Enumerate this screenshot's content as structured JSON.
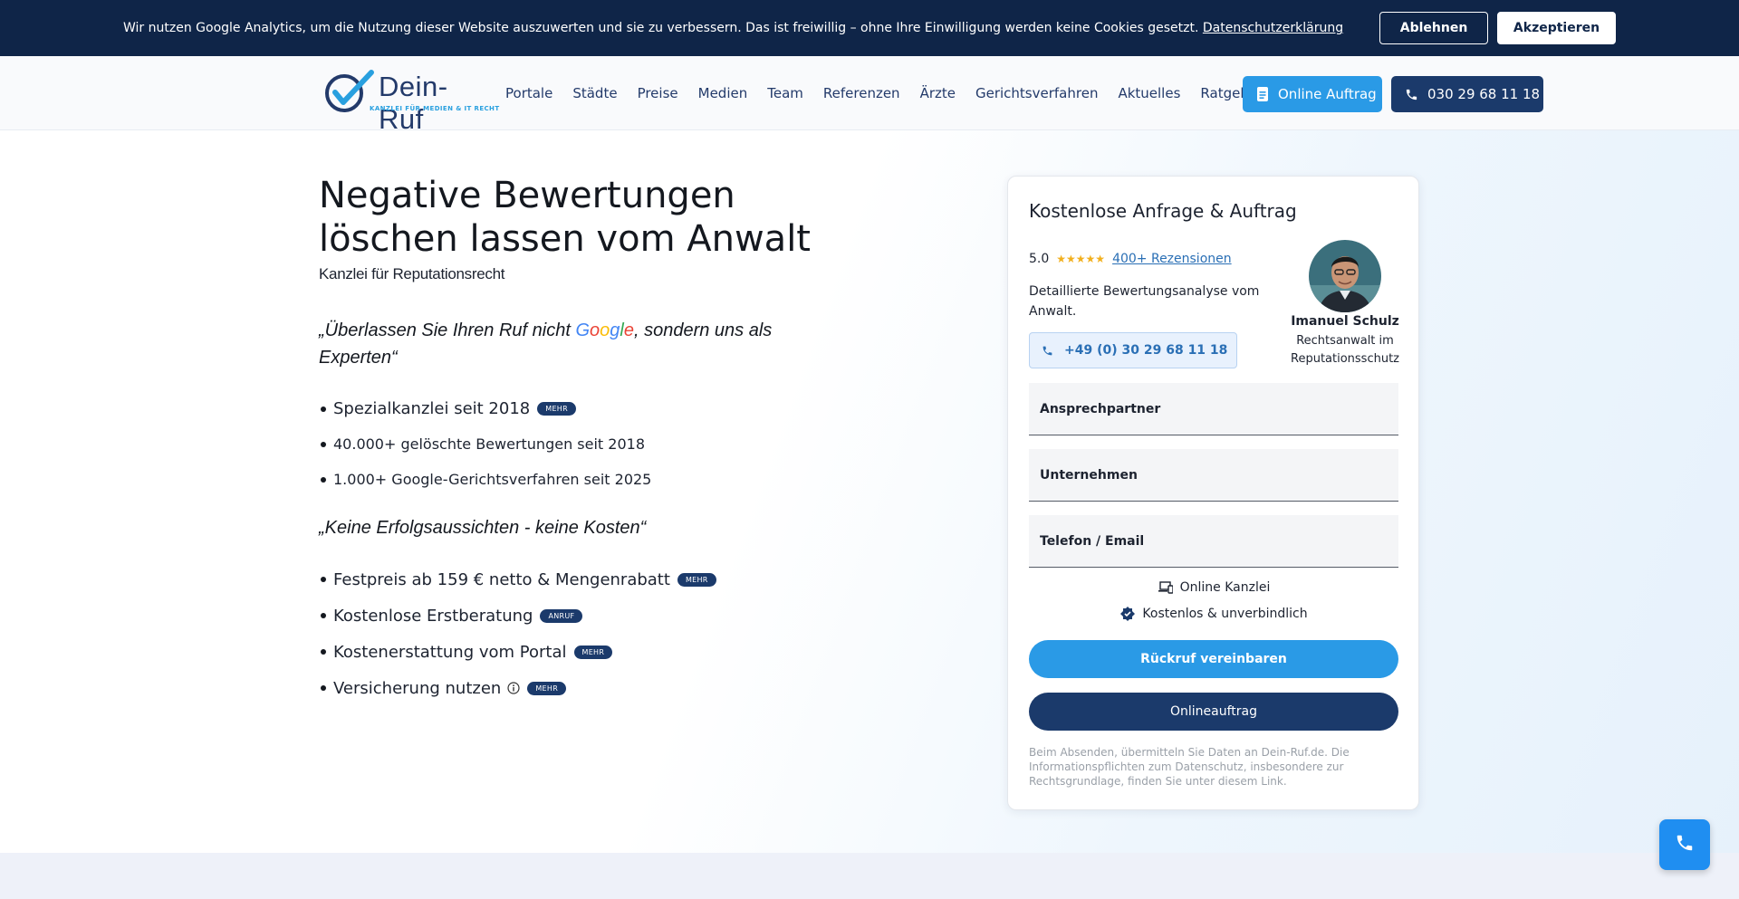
{
  "cookie_banner": {
    "text": "Wir nutzen Google Analytics, um die Nutzung dieser Website auszuwerten und sie zu verbessern. Das ist freiwillig – ohne Ihre Einwilligung werden keine Cookies gesetzt.",
    "link_label": "Datenschutzerklärung",
    "decline_label": "Ablehnen",
    "accept_label": "Akzeptieren"
  },
  "header": {
    "logo_text": "Dein-Ruf",
    "logo_subtitle": "KANZLEI FÜR MEDIEN & IT RECHT",
    "nav_items": [
      "Portale",
      "Städte",
      "Preise",
      "Medien",
      "Team",
      "Referenzen",
      "Ärzte",
      "Gerichtsverfahren",
      "Aktuelles",
      "Ratgeber"
    ],
    "order_button": "Online Auftrag",
    "phone_button": "030 29 68 11 18"
  },
  "hero": {
    "title_line1": "Negative Bewertungen",
    "title_line2": "löschen lassen vom Anwalt",
    "subtitle": "Kanzlei für Reputationsrecht",
    "quote1_start": "„Überlassen Sie Ihren Ruf nicht ",
    "quote1_google": [
      "G",
      "o",
      "o",
      "g",
      "l",
      "e"
    ],
    "quote1_end": ", sondern uns als Experten“",
    "list1": [
      {
        "text": "Spezialkanzlei seit 2018",
        "badge": "MEHR"
      },
      {
        "text": "40.000+ gelöschte Bewertungen seit 2018",
        "badge": ""
      },
      {
        "text": "1.000+ Google-Gerichtsverfahren seit 2025",
        "badge": ""
      }
    ],
    "quote2": "„Keine Erfolgsaussichten - keine Kosten“",
    "list2": [
      {
        "text": "Festpreis ab 159 € netto & Mengenrabatt",
        "badge": "MEHR"
      },
      {
        "text": "Kostenlose Erstberatung",
        "badge": "ANRUF"
      },
      {
        "text": "Kostenerstattung vom Portal",
        "badge": "MEHR"
      },
      {
        "text": "Versicherung nutzen",
        "badge": "MEHR"
      }
    ]
  },
  "form": {
    "title": "Kostenlose Anfrage & Auftrag",
    "rating_value": "5.0",
    "stars": "★★★★★",
    "reviews_link": "400+ Rezensionen",
    "analysis_text": "Detaillierte Bewertungsanalyse vom Anwalt.",
    "phone": "+49 (0) 30 29 68 11 18",
    "lawyer_name": "Imanuel Schulz",
    "lawyer_role": "Rechtsanwalt im Reputationsschutz",
    "fields": [
      "Ansprechpartner",
      "Unternehmen",
      "Telefon / Email"
    ],
    "feature1": "Online Kanzlei",
    "feature2": "Kostenlos & unverbindlich",
    "callback_button": "Rückruf vereinbaren",
    "online_button": "Onlineauftrag",
    "disclaimer": "Beim Absenden, übermitteln Sie Daten an Dein-Ruf.de. Die Informationspflichten zum Datenschutz, insbesondere zur Rechtsgrundlage, finden Sie unter diesem Link."
  },
  "colors": {
    "navy": "#0f2548",
    "brand_blue": "#1b3a6b",
    "accent_blue": "#2a9ae6",
    "star_gold": "#f2b01e"
  },
  "icons": {
    "order": "document-icon",
    "phone": "phone-icon",
    "feature1": "devices-icon",
    "feature2": "verified-badge-icon",
    "info": "info-icon",
    "fab": "phone-icon"
  }
}
